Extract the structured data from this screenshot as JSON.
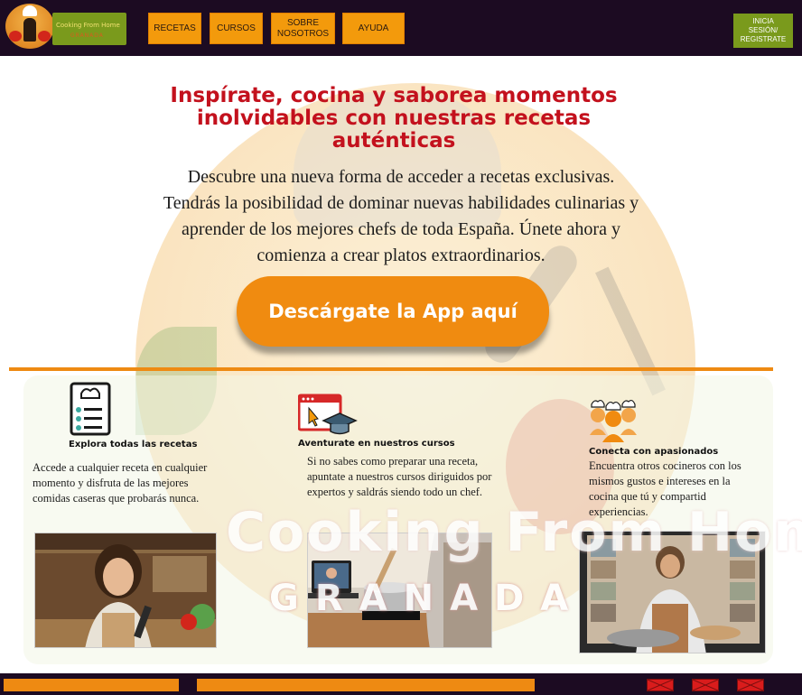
{
  "header": {
    "logo_name": "Cooking From Home",
    "logo_city": "GRANADA",
    "nav": [
      {
        "label": "RECETAS"
      },
      {
        "label": "CURSOS"
      },
      {
        "label": "SOBRE NOSOTROS"
      },
      {
        "label": "AYUDA"
      }
    ],
    "login_label": "INICIA SESIÓN/ REGISTRATE"
  },
  "hero": {
    "title": "Inspírate, cocina y saborea momentos inolvidables con nuestras recetas auténticas",
    "text": "Descubre una nueva forma de acceder a recetas exclusivas. Tendrás la posibilidad de dominar nuevas habilidades culinarias y aprender de los mejores chefs de toda España. Únete ahora y comienza a crear platos extraordinarios.",
    "cta_label": "Descárgate la App aquí"
  },
  "background": {
    "word": "Cooking From Home",
    "city": "GRANADA"
  },
  "features": [
    {
      "icon": "recipe-list-icon",
      "heading": "Explora todas las recetas",
      "text": "Accede a cualquier receta en cualquier momento y disfruta de las mejores comidas caseras que probarás nunca."
    },
    {
      "icon": "online-course-icon",
      "heading": "Aventurate en nuestros cursos",
      "text": "Si no sabes como preparar una receta, apuntate a nuestros cursos diriguidos por expertos y saldrás siendo todo un chef."
    },
    {
      "icon": "chef-community-icon",
      "heading": "Conecta con apasionados",
      "text": "Encuentra otros cocineros con los mismos gustos e intereses en la cocina que tú y compartid experiencias."
    }
  ],
  "footer": {
    "social_icons": [
      "social-icon-1",
      "social-icon-2",
      "social-icon-3"
    ]
  },
  "colors": {
    "header_bg": "#1c0b22",
    "accent_orange": "#f39a0c",
    "accent_green": "#7a9a1c",
    "title_red": "#c3111d"
  }
}
